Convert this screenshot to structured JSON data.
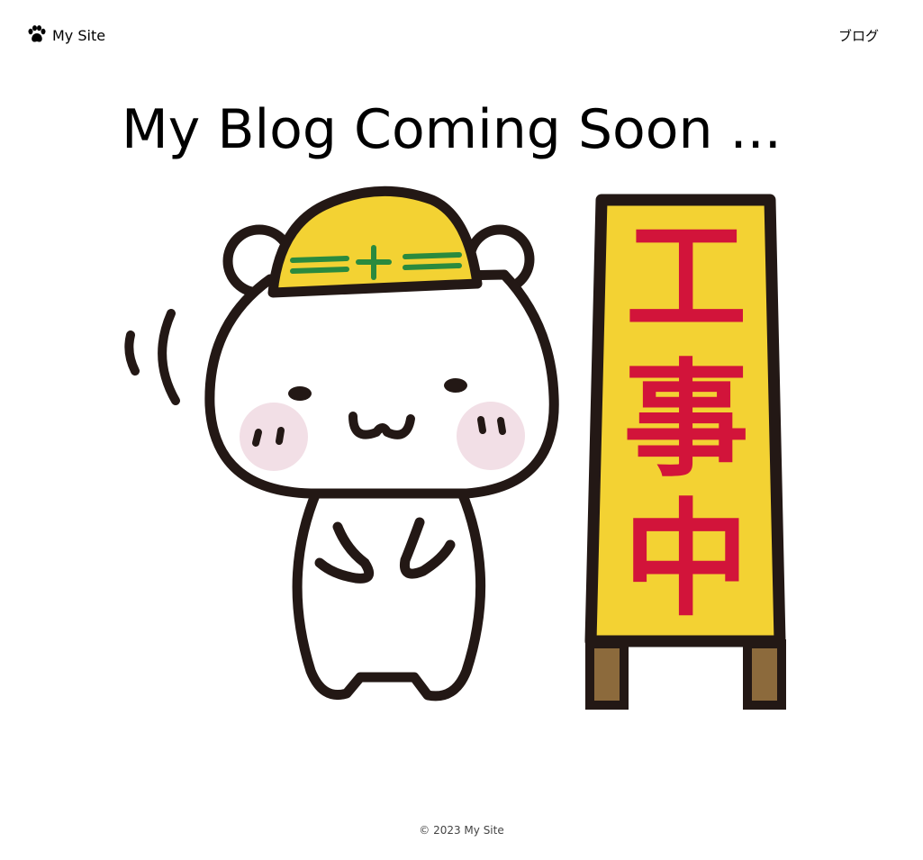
{
  "header": {
    "site_name": "My Site",
    "logo_icon": "paw-icon",
    "nav": [
      {
        "label": "ブログ"
      }
    ]
  },
  "main": {
    "title": "My Blog Coming Soon ...",
    "illustration": {
      "sign_text": [
        "工",
        "事",
        "中"
      ],
      "colors": {
        "helmet": "#f3d233",
        "helmet_stripe": "#2a8a3e",
        "sign_board": "#f3d233",
        "sign_text": "#d2143a",
        "cheeks": "#f2dfe6",
        "outline": "#231815",
        "legs": "#8c6a3c"
      }
    }
  },
  "footer": {
    "copyright": "© 2023 My Site"
  }
}
